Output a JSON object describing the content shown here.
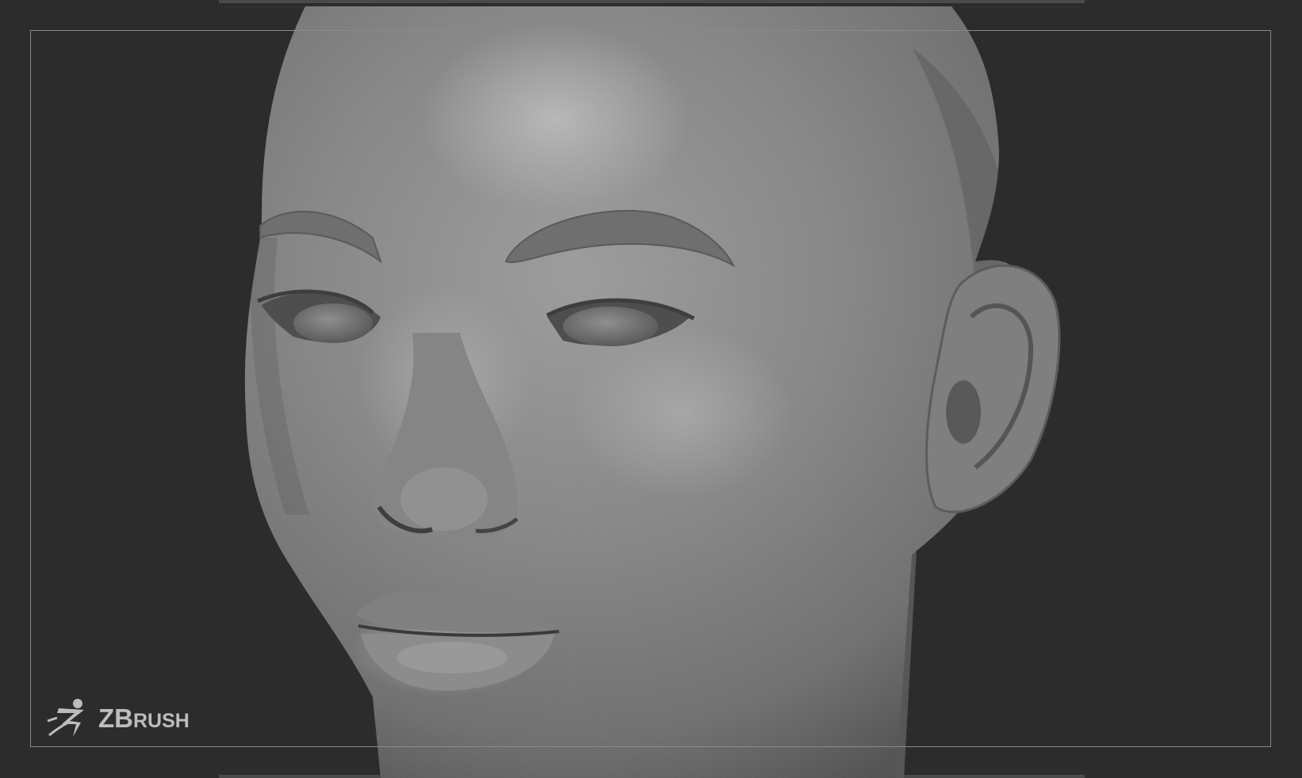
{
  "viewport": {
    "background": "#2c2c2c",
    "frame_color": "#8a8a8a"
  },
  "model": {
    "material": "matcap-grey-clay",
    "base_color": "#7d7d7d"
  },
  "logo": {
    "icon": "zbrush-runner-icon",
    "first": "ZB",
    "rest": "RUSH"
  }
}
